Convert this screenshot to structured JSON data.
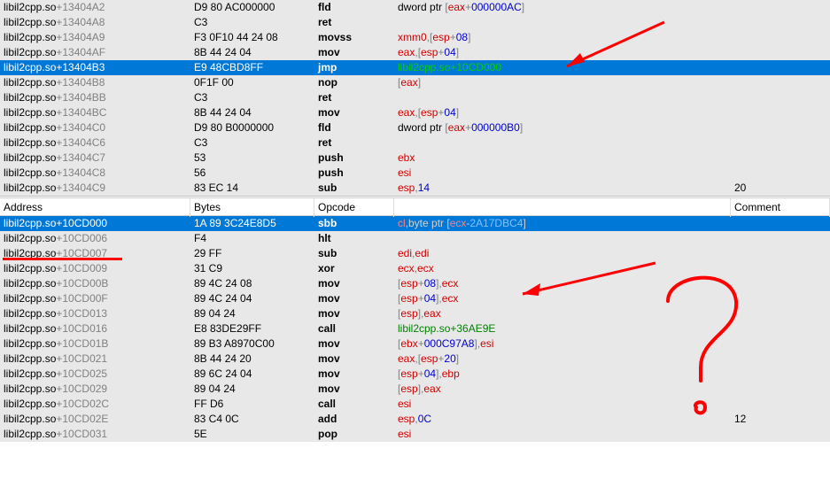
{
  "headers": {
    "address": "Address",
    "bytes": "Bytes",
    "opcode": "Opcode",
    "comment": "Comment"
  },
  "module": "libil2cpp.so",
  "colors": {
    "selected_bg": "#0078d7",
    "reg": "#d00000",
    "num": "#0000d0",
    "sym": "#008000",
    "annot": "#f00"
  },
  "pane1": {
    "selected_index": 4,
    "rows": [
      {
        "offset": "13404A2",
        "bytes": "D9 80 AC000000",
        "opcode": "fld",
        "ops": [
          {
            "t": "plain",
            "v": "dword ptr "
          },
          {
            "t": "punc",
            "v": "["
          },
          {
            "t": "reg",
            "v": "eax"
          },
          {
            "t": "punc",
            "v": "+"
          },
          {
            "t": "num",
            "v": "000000AC"
          },
          {
            "t": "punc",
            "v": "]"
          }
        ],
        "comment": ""
      },
      {
        "offset": "13404A8",
        "bytes": "C3",
        "opcode": "ret",
        "ops": [],
        "comment": ""
      },
      {
        "offset": "13404A9",
        "bytes": "F3 0F10 44 24 08",
        "opcode": "movss",
        "ops": [
          {
            "t": "reg",
            "v": "xmm0"
          },
          {
            "t": "punc",
            "v": ",["
          },
          {
            "t": "reg",
            "v": "esp"
          },
          {
            "t": "punc",
            "v": "+"
          },
          {
            "t": "num",
            "v": "08"
          },
          {
            "t": "punc",
            "v": "]"
          }
        ],
        "comment": ""
      },
      {
        "offset": "13404AF",
        "bytes": "8B 44 24 04",
        "opcode": "mov",
        "ops": [
          {
            "t": "reg",
            "v": "eax"
          },
          {
            "t": "punc",
            "v": ",["
          },
          {
            "t": "reg",
            "v": "esp"
          },
          {
            "t": "punc",
            "v": "+"
          },
          {
            "t": "num",
            "v": "04"
          },
          {
            "t": "punc",
            "v": "]"
          }
        ],
        "comment": ""
      },
      {
        "offset": "13404B3",
        "bytes": "E9 48CBD8FF",
        "opcode": "jmp",
        "ops": [
          {
            "t": "sym",
            "v": "libil2cpp.so+10CD000"
          }
        ],
        "comment": ""
      },
      {
        "offset": "13404B8",
        "bytes": "0F1F 00",
        "opcode": "nop",
        "ops": [
          {
            "t": "punc",
            "v": "["
          },
          {
            "t": "reg",
            "v": "eax"
          },
          {
            "t": "punc",
            "v": "]"
          }
        ],
        "comment": ""
      },
      {
        "offset": "13404BB",
        "bytes": "C3",
        "opcode": "ret",
        "ops": [],
        "comment": ""
      },
      {
        "offset": "13404BC",
        "bytes": "8B 44 24 04",
        "opcode": "mov",
        "ops": [
          {
            "t": "reg",
            "v": "eax"
          },
          {
            "t": "punc",
            "v": ",["
          },
          {
            "t": "reg",
            "v": "esp"
          },
          {
            "t": "punc",
            "v": "+"
          },
          {
            "t": "num",
            "v": "04"
          },
          {
            "t": "punc",
            "v": "]"
          }
        ],
        "comment": ""
      },
      {
        "offset": "13404C0",
        "bytes": "D9 80 B0000000",
        "opcode": "fld",
        "ops": [
          {
            "t": "plain",
            "v": "dword ptr "
          },
          {
            "t": "punc",
            "v": "["
          },
          {
            "t": "reg",
            "v": "eax"
          },
          {
            "t": "punc",
            "v": "+"
          },
          {
            "t": "num",
            "v": "000000B0"
          },
          {
            "t": "punc",
            "v": "]"
          }
        ],
        "comment": ""
      },
      {
        "offset": "13404C6",
        "bytes": "C3",
        "opcode": "ret",
        "ops": [],
        "comment": ""
      },
      {
        "offset": "13404C7",
        "bytes": "53",
        "opcode": "push",
        "ops": [
          {
            "t": "reg",
            "v": "ebx"
          }
        ],
        "comment": ""
      },
      {
        "offset": "13404C8",
        "bytes": "56",
        "opcode": "push",
        "ops": [
          {
            "t": "reg",
            "v": "esi"
          }
        ],
        "comment": ""
      },
      {
        "offset": "13404C9",
        "bytes": "83 EC 14",
        "opcode": "sub",
        "ops": [
          {
            "t": "reg",
            "v": "esp"
          },
          {
            "t": "punc",
            "v": ","
          },
          {
            "t": "num",
            "v": "14"
          }
        ],
        "comment": "20"
      }
    ]
  },
  "pane2": {
    "selected_index": 0,
    "rows": [
      {
        "offset": "10CD000",
        "bytes": "1A 89 3C24E8D5",
        "opcode": "sbb",
        "ops": [
          {
            "t": "reg",
            "v": "cl"
          },
          {
            "t": "punc",
            "v": ",byte ptr ["
          },
          {
            "t": "reg",
            "v": "ecx"
          },
          {
            "t": "punc",
            "v": "-"
          },
          {
            "t": "num",
            "v": "2A17DBC4"
          },
          {
            "t": "punc",
            "v": "]"
          }
        ],
        "comment": ""
      },
      {
        "offset": "10CD006",
        "bytes": "F4",
        "opcode": "hlt",
        "ops": [],
        "comment": ""
      },
      {
        "offset": "10CD007",
        "bytes": "29 FF",
        "opcode": "sub",
        "ops": [
          {
            "t": "reg",
            "v": "edi"
          },
          {
            "t": "punc",
            "v": ","
          },
          {
            "t": "reg",
            "v": "edi"
          }
        ],
        "comment": ""
      },
      {
        "offset": "10CD009",
        "bytes": "31 C9",
        "opcode": "xor",
        "ops": [
          {
            "t": "reg",
            "v": "ecx"
          },
          {
            "t": "punc",
            "v": ","
          },
          {
            "t": "reg",
            "v": "ecx"
          }
        ],
        "comment": ""
      },
      {
        "offset": "10CD00B",
        "bytes": "89 4C 24 08",
        "opcode": "mov",
        "ops": [
          {
            "t": "punc",
            "v": "["
          },
          {
            "t": "reg",
            "v": "esp"
          },
          {
            "t": "punc",
            "v": "+"
          },
          {
            "t": "num",
            "v": "08"
          },
          {
            "t": "punc",
            "v": "],"
          },
          {
            "t": "reg",
            "v": "ecx"
          }
        ],
        "comment": ""
      },
      {
        "offset": "10CD00F",
        "bytes": "89 4C 24 04",
        "opcode": "mov",
        "ops": [
          {
            "t": "punc",
            "v": "["
          },
          {
            "t": "reg",
            "v": "esp"
          },
          {
            "t": "punc",
            "v": "+"
          },
          {
            "t": "num",
            "v": "04"
          },
          {
            "t": "punc",
            "v": "],"
          },
          {
            "t": "reg",
            "v": "ecx"
          }
        ],
        "comment": ""
      },
      {
        "offset": "10CD013",
        "bytes": "89 04 24",
        "opcode": "mov",
        "ops": [
          {
            "t": "punc",
            "v": "["
          },
          {
            "t": "reg",
            "v": "esp"
          },
          {
            "t": "punc",
            "v": "],"
          },
          {
            "t": "reg",
            "v": "eax"
          }
        ],
        "comment": ""
      },
      {
        "offset": "10CD016",
        "bytes": "E8 83DE29FF",
        "opcode": "call",
        "ops": [
          {
            "t": "sym",
            "v": "libil2cpp.so+36AE9E"
          }
        ],
        "comment": ""
      },
      {
        "offset": "10CD01B",
        "bytes": "89 B3 A8970C00",
        "opcode": "mov",
        "ops": [
          {
            "t": "punc",
            "v": "["
          },
          {
            "t": "reg",
            "v": "ebx"
          },
          {
            "t": "punc",
            "v": "+"
          },
          {
            "t": "num",
            "v": "000C97A8"
          },
          {
            "t": "punc",
            "v": "],"
          },
          {
            "t": "reg",
            "v": "esi"
          }
        ],
        "comment": ""
      },
      {
        "offset": "10CD021",
        "bytes": "8B 44 24 20",
        "opcode": "mov",
        "ops": [
          {
            "t": "reg",
            "v": "eax"
          },
          {
            "t": "punc",
            "v": ",["
          },
          {
            "t": "reg",
            "v": "esp"
          },
          {
            "t": "punc",
            "v": "+"
          },
          {
            "t": "num",
            "v": "20"
          },
          {
            "t": "punc",
            "v": "]"
          }
        ],
        "comment": ""
      },
      {
        "offset": "10CD025",
        "bytes": "89 6C 24 04",
        "opcode": "mov",
        "ops": [
          {
            "t": "punc",
            "v": "["
          },
          {
            "t": "reg",
            "v": "esp"
          },
          {
            "t": "punc",
            "v": "+"
          },
          {
            "t": "num",
            "v": "04"
          },
          {
            "t": "punc",
            "v": "],"
          },
          {
            "t": "reg",
            "v": "ebp"
          }
        ],
        "comment": ""
      },
      {
        "offset": "10CD029",
        "bytes": "89 04 24",
        "opcode": "mov",
        "ops": [
          {
            "t": "punc",
            "v": "["
          },
          {
            "t": "reg",
            "v": "esp"
          },
          {
            "t": "punc",
            "v": "],"
          },
          {
            "t": "reg",
            "v": "eax"
          }
        ],
        "comment": ""
      },
      {
        "offset": "10CD02C",
        "bytes": "FF D6",
        "opcode": "call",
        "ops": [
          {
            "t": "reg",
            "v": "esi"
          }
        ],
        "comment": ""
      },
      {
        "offset": "10CD02E",
        "bytes": "83 C4 0C",
        "opcode": "add",
        "ops": [
          {
            "t": "reg",
            "v": "esp"
          },
          {
            "t": "punc",
            "v": ","
          },
          {
            "t": "num",
            "v": "0C"
          }
        ],
        "comment": "12"
      },
      {
        "offset": "10CD031",
        "bytes": "5E",
        "opcode": "pop",
        "ops": [
          {
            "t": "reg",
            "v": "esi"
          }
        ],
        "comment": ""
      }
    ]
  }
}
